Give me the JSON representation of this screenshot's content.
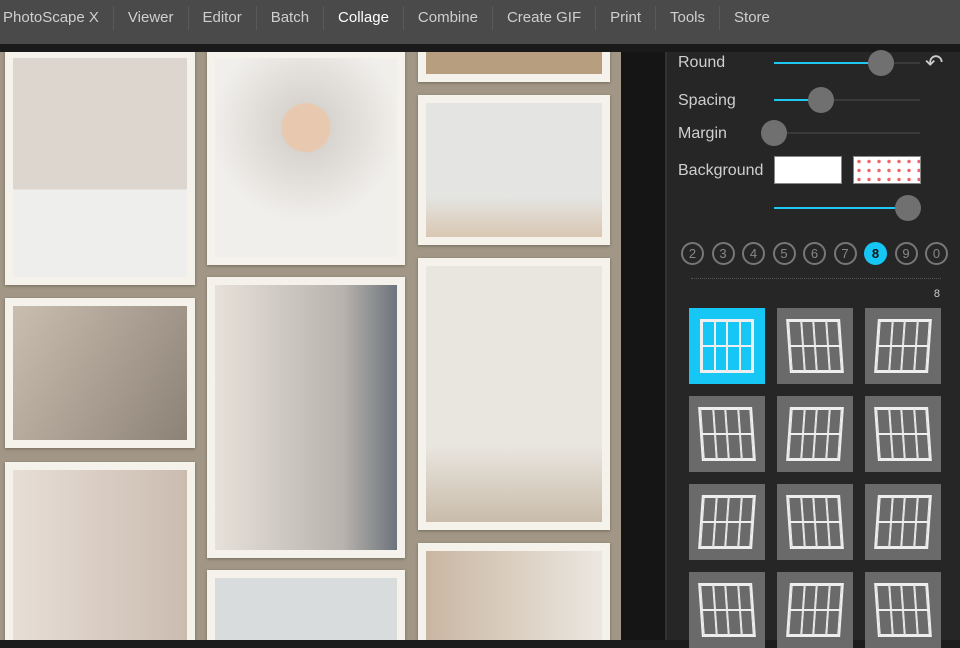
{
  "nav": {
    "tabs": [
      "PhotoScape X",
      "Viewer",
      "Editor",
      "Batch",
      "Collage",
      "Combine",
      "Create GIF",
      "Print",
      "Tools",
      "Store"
    ],
    "active": "Collage"
  },
  "panel": {
    "round_label": "Round",
    "spacing_label": "Spacing",
    "margin_label": "Margin",
    "background_label": "Background",
    "round_value": 0.73,
    "spacing_value": 0.32,
    "margin_value": 0,
    "background_opacity": 0.92,
    "photo_counts": [
      "2",
      "3",
      "4",
      "5",
      "6",
      "7",
      "8",
      "9",
      "0"
    ],
    "selected_count": "8",
    "layout_count_label": "8"
  },
  "colors": {
    "accent": "#16c6f5",
    "canvas_bg": "#a29786"
  }
}
